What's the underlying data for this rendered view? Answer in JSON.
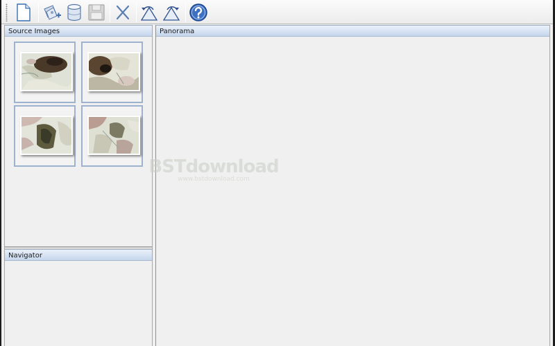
{
  "toolbar": {
    "buttons": [
      {
        "name": "new-project",
        "icon": "new-document-icon"
      },
      {
        "name": "add-images",
        "icon": "add-images-icon"
      },
      {
        "name": "open-project",
        "icon": "database-icon"
      },
      {
        "name": "save-project",
        "icon": "save-disk-icon",
        "enabled": false
      },
      {
        "name": "remove-image",
        "icon": "remove-x-icon"
      },
      {
        "name": "rotate-left",
        "icon": "rotate-left-icon"
      },
      {
        "name": "rotate-right",
        "icon": "rotate-right-icon"
      },
      {
        "name": "help",
        "icon": "help-icon"
      }
    ]
  },
  "source_images": {
    "title": "Source Images",
    "thumbnails": [
      {
        "name": "source-image-1"
      },
      {
        "name": "source-image-2"
      },
      {
        "name": "source-image-3"
      },
      {
        "name": "source-image-4"
      }
    ]
  },
  "navigator": {
    "title": "Navigator"
  },
  "panorama": {
    "title": "Panorama"
  },
  "watermark": {
    "main": "BSTdownload",
    "sub": "www.bstdownload.com"
  },
  "colors": {
    "header_gradient_top": "#eaf1fa",
    "header_gradient_bottom": "#c5d6ec",
    "thumb_border": "#9cb2cf",
    "help_icon": "#2f5fb3"
  }
}
